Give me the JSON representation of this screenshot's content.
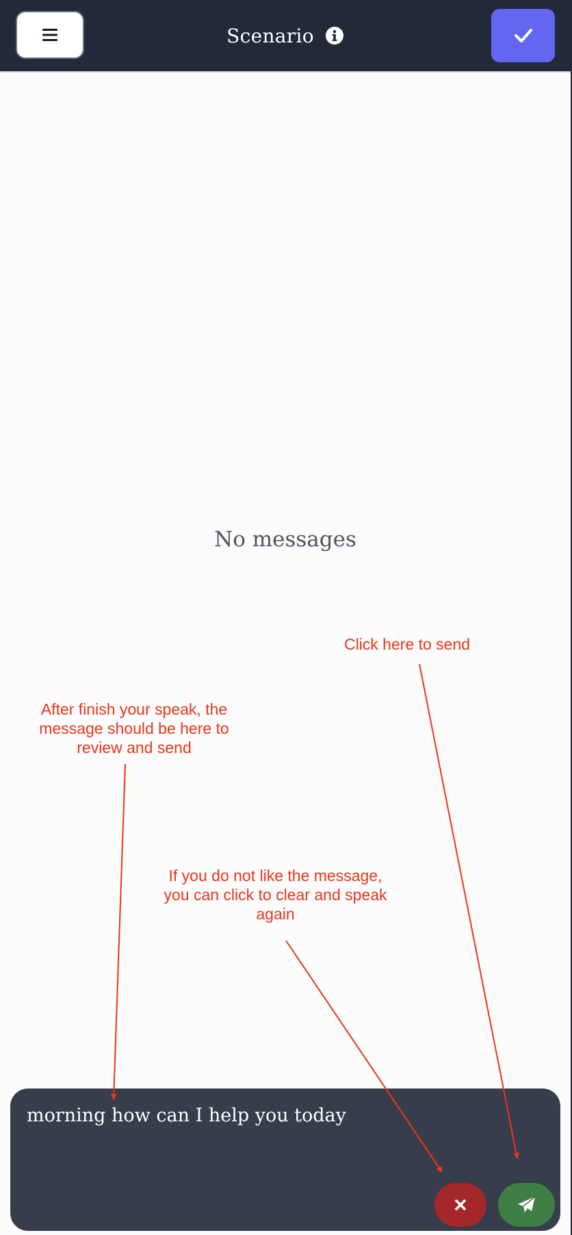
{
  "header": {
    "title": "Scenario",
    "menu_icon": "hamburger-menu-icon",
    "info_icon": "info-circle-icon",
    "confirm_icon": "check-icon"
  },
  "chat": {
    "empty_text": "No messages"
  },
  "annotations": {
    "send_hint": "Click here to send",
    "message_hint": "After finish your speak, the\nmessage should be here to\nreview and send",
    "clear_hint": "If you do not like the message,\nyou can click to clear and speak\nagain"
  },
  "composer": {
    "value": "morning how can I help you today",
    "clear_icon": "close-icon",
    "send_icon": "paper-plane-icon"
  },
  "colors": {
    "header_bg": "#232939",
    "accent": "#6366f1",
    "composer_bg": "#383d4c",
    "clear_button": "#a4282a",
    "send_button": "#3f7f45",
    "annotation": "#e8361b"
  }
}
